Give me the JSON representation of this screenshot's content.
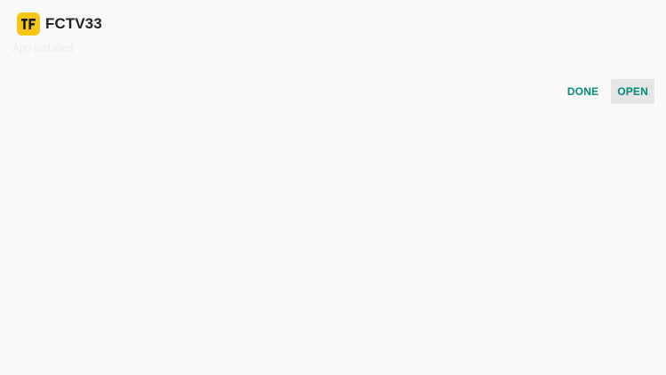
{
  "app": {
    "name": "FCTV33",
    "icon": "fctv-logo-icon",
    "icon_color": "#f5c518",
    "status": "App installed"
  },
  "actions": {
    "done_label": "DONE",
    "open_label": "OPEN",
    "accent_color": "#00897b"
  }
}
